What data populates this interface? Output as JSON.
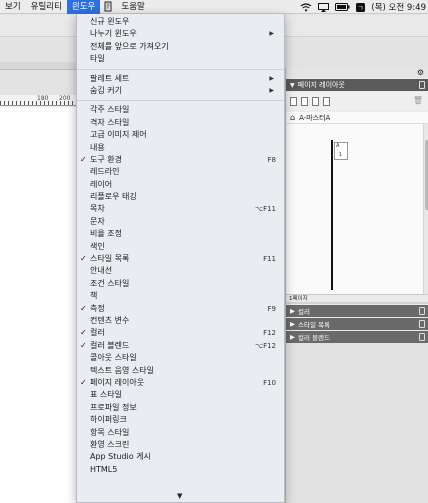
{
  "menubar": {
    "items": [
      "보기",
      "유틸리티",
      "윈도우"
    ],
    "help": "도움말",
    "battery": "100",
    "clock": "(목) 오전 9:49",
    "accent": "#2f6fde"
  },
  "ruler": {
    "labels": [
      "180",
      "200"
    ]
  },
  "panel": {
    "pages_title": "페이지 레이아웃",
    "master_label": "A-마스터A",
    "page_letter": "A",
    "page_number": "1",
    "page_count": "1페이지",
    "collapsed": [
      "컬러",
      "스타일 목록",
      "컬러 블렌드"
    ]
  },
  "menu": {
    "group1": [
      {
        "label": "신규 윈도우"
      },
      {
        "label": "나누기 윈도우",
        "submenu": true
      },
      {
        "label": "전체를 앞으로 가져오기"
      },
      {
        "label": "타일"
      }
    ],
    "group2": [
      {
        "label": "팔레트 세트",
        "submenu": true
      },
      {
        "label": "숨김 커기",
        "submenu": true
      }
    ],
    "group3": [
      {
        "label": "각주 스타일"
      },
      {
        "label": "격자 스타일"
      },
      {
        "label": "고급 이미지 제어"
      },
      {
        "label": "내용"
      },
      {
        "label": "도구 환경",
        "checked": true,
        "shortcut": "F8"
      },
      {
        "label": "레드라인"
      },
      {
        "label": "레이어"
      },
      {
        "label": "리플로우 태깅"
      },
      {
        "label": "목차",
        "shortcut": "⌥F11"
      },
      {
        "label": "문자"
      },
      {
        "label": "비율 조정"
      },
      {
        "label": "색인"
      },
      {
        "label": "스타일 목록",
        "checked": true,
        "shortcut": "F11"
      },
      {
        "label": "안내선"
      },
      {
        "label": "조건 스타일"
      },
      {
        "label": "책"
      },
      {
        "label": "측정",
        "checked": true,
        "shortcut": "F9"
      },
      {
        "label": "컨텐츠 변수"
      },
      {
        "label": "컬러",
        "checked": true,
        "shortcut": "F12"
      },
      {
        "label": "컬러 블렌드",
        "checked": true,
        "shortcut": "⌥F12"
      },
      {
        "label": "콜아웃 스타일"
      },
      {
        "label": "텍스트 음영 스타일"
      },
      {
        "label": "페이지 레이아웃",
        "checked": true,
        "shortcut": "F10"
      },
      {
        "label": "표 스타일"
      },
      {
        "label": "프로파일 정보"
      },
      {
        "label": "하이퍼링크"
      },
      {
        "label": "항목 스타일"
      },
      {
        "label": "환영 스크린"
      },
      {
        "label": "App Studio 게시"
      },
      {
        "label": "HTML5"
      }
    ],
    "scroll_indicator": "▼"
  }
}
